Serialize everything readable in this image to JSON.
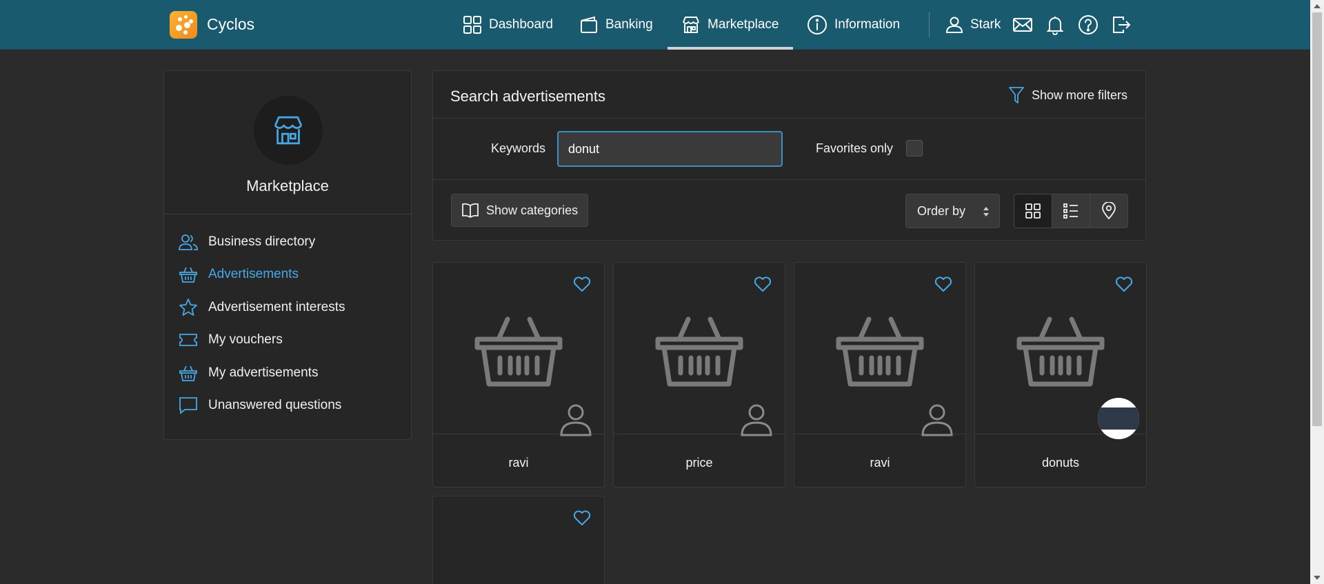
{
  "app": {
    "brand": "Cyclos"
  },
  "nav": {
    "dashboard": "Dashboard",
    "banking": "Banking",
    "marketplace": "Marketplace",
    "information": "Information",
    "user": "Stark"
  },
  "sidebar": {
    "title": "Marketplace",
    "items": [
      {
        "label": "Business directory",
        "icon": "users-icon"
      },
      {
        "label": "Advertisements",
        "icon": "basket-icon",
        "active": true
      },
      {
        "label": "Advertisement interests",
        "icon": "star-icon"
      },
      {
        "label": "My vouchers",
        "icon": "ticket-icon"
      },
      {
        "label": "My advertisements",
        "icon": "basket-icon"
      },
      {
        "label": "Unanswered questions",
        "icon": "chat-icon"
      }
    ]
  },
  "search": {
    "title": "Search advertisements",
    "more_filters": "Show more filters",
    "keywords_label": "Keywords",
    "keywords_value": "donut",
    "favorites_label": "Favorites only",
    "favorites_checked": false,
    "categories_button": "Show categories",
    "order_by": "Order by",
    "view_modes": [
      "grid",
      "list",
      "map"
    ],
    "active_view": "grid"
  },
  "results": [
    {
      "title": "ravi",
      "owner": "default-avatar"
    },
    {
      "title": "price",
      "owner": "default-avatar"
    },
    {
      "title": "ravi",
      "owner": "default-avatar"
    },
    {
      "title": "donuts",
      "owner": "photo-avatar"
    },
    {
      "title": "",
      "owner": ""
    }
  ],
  "colors": {
    "topbar": "#1a5a6e",
    "accent": "#46a9e6",
    "background": "#2b2b2b",
    "panel": "#262626"
  }
}
